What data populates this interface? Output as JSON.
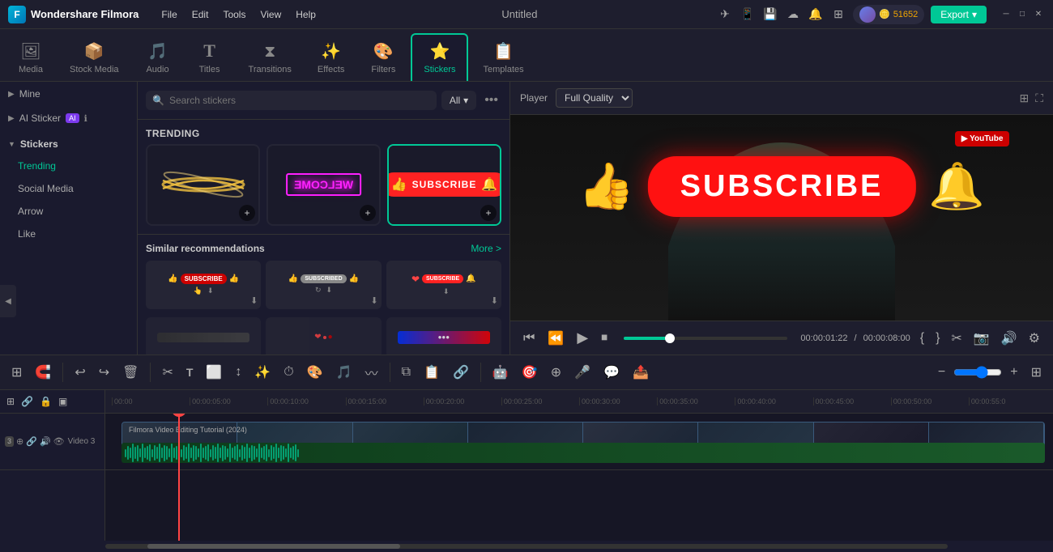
{
  "app": {
    "name": "Wondershare Filmora",
    "title": "Untitled",
    "logo_char": "F"
  },
  "menu": {
    "items": [
      "File",
      "Edit",
      "Tools",
      "View",
      "Help"
    ]
  },
  "nav": {
    "items": [
      {
        "id": "media",
        "label": "Media",
        "icon": "🖼"
      },
      {
        "id": "stock",
        "label": "Stock Media",
        "icon": "📦"
      },
      {
        "id": "audio",
        "label": "Audio",
        "icon": "🎵"
      },
      {
        "id": "titles",
        "label": "Titles",
        "icon": "T"
      },
      {
        "id": "transitions",
        "label": "Transitions",
        "icon": "⧗"
      },
      {
        "id": "effects",
        "label": "Effects",
        "icon": "✨"
      },
      {
        "id": "filters",
        "label": "Filters",
        "icon": "🔮"
      },
      {
        "id": "stickers",
        "label": "Stickers",
        "icon": "⭐",
        "active": true
      },
      {
        "id": "templates",
        "label": "Templates",
        "icon": "📋"
      }
    ]
  },
  "sidebar": {
    "mine_label": "Mine",
    "ai_sticker_label": "AI Sticker",
    "stickers_label": "Stickers",
    "trending_label": "Trending",
    "social_media_label": "Social Media",
    "arrow_label": "Arrow",
    "like_label": "Like"
  },
  "search": {
    "placeholder": "Search stickers",
    "filter_label": "All"
  },
  "stickers": {
    "trending_label": "TRENDING",
    "similar_label": "Similar recommendations",
    "more_label": "More >"
  },
  "player": {
    "label": "Player",
    "quality": "Full Quality",
    "time_current": "00:00:01:22",
    "time_total": "00:00:08:00",
    "progress_pct": 28
  },
  "toolbar": {
    "zoom_label": "Zoom"
  },
  "timeline": {
    "marks": [
      "00:00",
      "00:00:05:00",
      "00:00:10:00",
      "00:00:15:00",
      "00:00:20:00",
      "00:00:25:00",
      "00:00:30:00",
      "00:00:35:00",
      "00:00:40:00",
      "00:00:45:00",
      "00:00:50:00",
      "00:00:55:0"
    ],
    "track_label": "Video 3",
    "track_number": "3",
    "clip_label": "Filmora Video Editing Tutorial (2024)"
  },
  "coins": {
    "amount": "51652"
  },
  "export_label": "Export"
}
